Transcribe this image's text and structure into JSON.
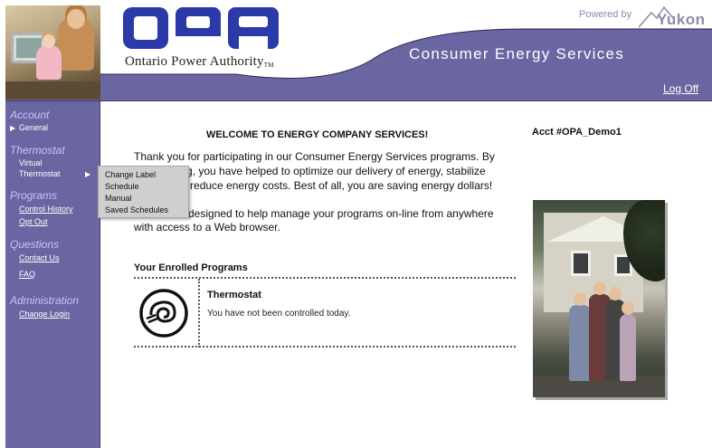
{
  "header": {
    "brand_logo": "OPA",
    "brand_subtitle": "Ontario Power Authority",
    "brand_tm": "TM",
    "powered_by": "Powered by",
    "partner_logo": "Yukon",
    "section_title": "Consumer Energy Services",
    "logoff_label": "Log Off",
    "colors": {
      "band": "#6a66a1",
      "logo_blue": "#2b3aa8"
    }
  },
  "sidebar": {
    "account": {
      "heading": "Account",
      "items": [
        {
          "label": "General",
          "arrow": "▶"
        }
      ]
    },
    "thermostat": {
      "heading": "Thermostat",
      "items": [
        {
          "label": "Virtual"
        },
        {
          "label": "Thermostat",
          "arrow": "▶"
        }
      ]
    },
    "programs": {
      "heading": "Programs",
      "items": [
        {
          "label": "Control History"
        },
        {
          "label": "Opt Out"
        }
      ]
    },
    "questions": {
      "heading": "Questions",
      "items": [
        {
          "label": "Contact Us"
        },
        {
          "label": "FAQ"
        }
      ]
    },
    "administration": {
      "heading": "Administration",
      "items": [
        {
          "label": "Change Login"
        }
      ]
    }
  },
  "flyout_menu": {
    "items": [
      {
        "label": "Change Label"
      },
      {
        "label": "Schedule"
      },
      {
        "label": "Manual"
      },
      {
        "label": "Saved Schedules"
      }
    ]
  },
  "main": {
    "welcome_title": "WELCOME TO ENERGY COMPANY SERVICES!",
    "account_number": "Acct #OPA_Demo1",
    "intro_text": "Thank you for participating in our Consumer Energy Services programs. By participating, you have helped to optimize our delivery of energy, stabilize prices, and reduce energy costs. Best of all, you are saving energy dollars!",
    "intro_text_2": "This site is designed to help manage your programs on-line from anywhere with access to a Web browser.",
    "enrolled_title": "Your Enrolled Programs",
    "programs": [
      {
        "name": "Thermostat",
        "status": "You have not been controlled today.",
        "icon": "thermostat-swirl-icon"
      }
    ]
  }
}
